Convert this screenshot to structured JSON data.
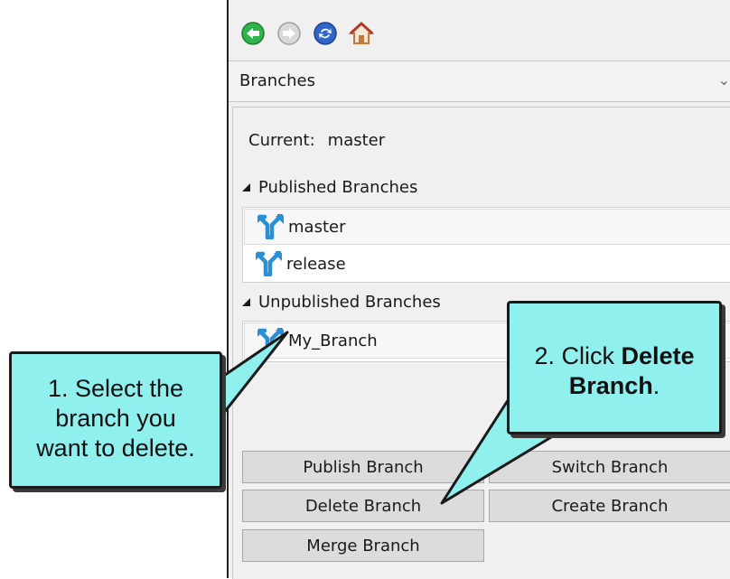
{
  "toolbar": {
    "icons": [
      "back-icon",
      "forward-icon",
      "refresh-icon",
      "home-icon"
    ],
    "colors": {
      "back": "#2fb34a",
      "forward": "#bcbcbc",
      "refresh": "#2f66c8",
      "home": "#c8763a"
    }
  },
  "header": {
    "title": "Branches"
  },
  "current": {
    "label": "Current:",
    "value": "master"
  },
  "published": {
    "label": "Published Branches",
    "items": [
      {
        "name": "master",
        "selected": true
      },
      {
        "name": "release",
        "selected": false
      }
    ]
  },
  "unpublished": {
    "label": "Unpublished Branches",
    "items": [
      {
        "name": "My_Branch",
        "selected": true
      }
    ]
  },
  "buttons": {
    "publish": "Publish Branch",
    "switch": "Switch Branch",
    "delete": "Delete Branch",
    "create": "Create Branch",
    "merge": "Merge Branch"
  },
  "callout1": {
    "line1": "1. Select the",
    "line2": "branch you",
    "line3": "want to delete."
  },
  "callout2": {
    "prefix": "2. Click",
    "bold_line1": "Delete",
    "bold_line2": "Branch",
    "suffix": "."
  },
  "accent_colors": {
    "callout_fill": "#8ff0ee",
    "branch_icon": "#2b8fd6"
  }
}
